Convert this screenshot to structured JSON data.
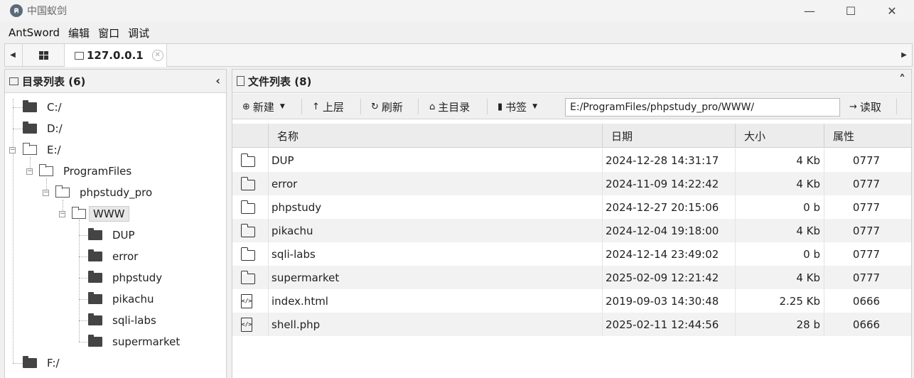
{
  "window": {
    "title": "中国蚁剑",
    "logo_glyph": "ฅ",
    "controls": {
      "minimize": "—",
      "maximize": "☐",
      "close": "✕"
    }
  },
  "menu": [
    "AntSword",
    "编辑",
    "窗口",
    "调试"
  ],
  "tabs": {
    "left_arrow": "◀",
    "right_arrow": "▶",
    "active_tab": "127.0.0.1",
    "close_glyph": "✕"
  },
  "dir_panel": {
    "title": "目录列表 (6)",
    "collapse_glyph": "‹",
    "nodes": [
      {
        "label": "C:/"
      },
      {
        "label": "D:/"
      },
      {
        "label": "E:/"
      },
      {
        "label": "ProgramFiles"
      },
      {
        "label": "phpstudy_pro"
      },
      {
        "label": "WWW"
      },
      {
        "label": "DUP"
      },
      {
        "label": "error"
      },
      {
        "label": "phpstudy"
      },
      {
        "label": "pikachu"
      },
      {
        "label": "sqli-labs"
      },
      {
        "label": "supermarket"
      },
      {
        "label": "F:/"
      }
    ]
  },
  "file_panel": {
    "title": "文件列表 (8)",
    "collapse_glyph": "˄",
    "toolbar": {
      "new": "新建",
      "up": "上层",
      "refresh": "刷新",
      "home": "主目录",
      "bookmark": "书签",
      "path": "E:/ProgramFiles/phpstudy_pro/WWW/",
      "read": "读取"
    },
    "columns": {
      "name": "名称",
      "date": "日期",
      "size": "大小",
      "attr": "属性"
    },
    "files": [
      {
        "type": "folder",
        "name": "DUP",
        "date": "2024-12-28 14:31:17",
        "size": "4 Kb",
        "attr": "0777"
      },
      {
        "type": "folder",
        "name": "error",
        "date": "2024-11-09 14:22:42",
        "size": "4 Kb",
        "attr": "0777"
      },
      {
        "type": "folder",
        "name": "phpstudy",
        "date": "2024-12-27 20:15:06",
        "size": "0 b",
        "attr": "0777"
      },
      {
        "type": "folder",
        "name": "pikachu",
        "date": "2024-12-04 19:18:00",
        "size": "4 Kb",
        "attr": "0777"
      },
      {
        "type": "folder",
        "name": "sqli-labs",
        "date": "2024-12-14 23:49:02",
        "size": "0 b",
        "attr": "0777"
      },
      {
        "type": "folder",
        "name": "supermarket",
        "date": "2025-02-09 12:21:42",
        "size": "4 Kb",
        "attr": "0777"
      },
      {
        "type": "file",
        "name": "index.html",
        "date": "2019-09-03 14:30:48",
        "size": "2.25 Kb",
        "attr": "0666"
      },
      {
        "type": "file",
        "name": "shell.php",
        "date": "2025-02-11 12:44:56",
        "size": "28 b",
        "attr": "0666"
      }
    ]
  }
}
